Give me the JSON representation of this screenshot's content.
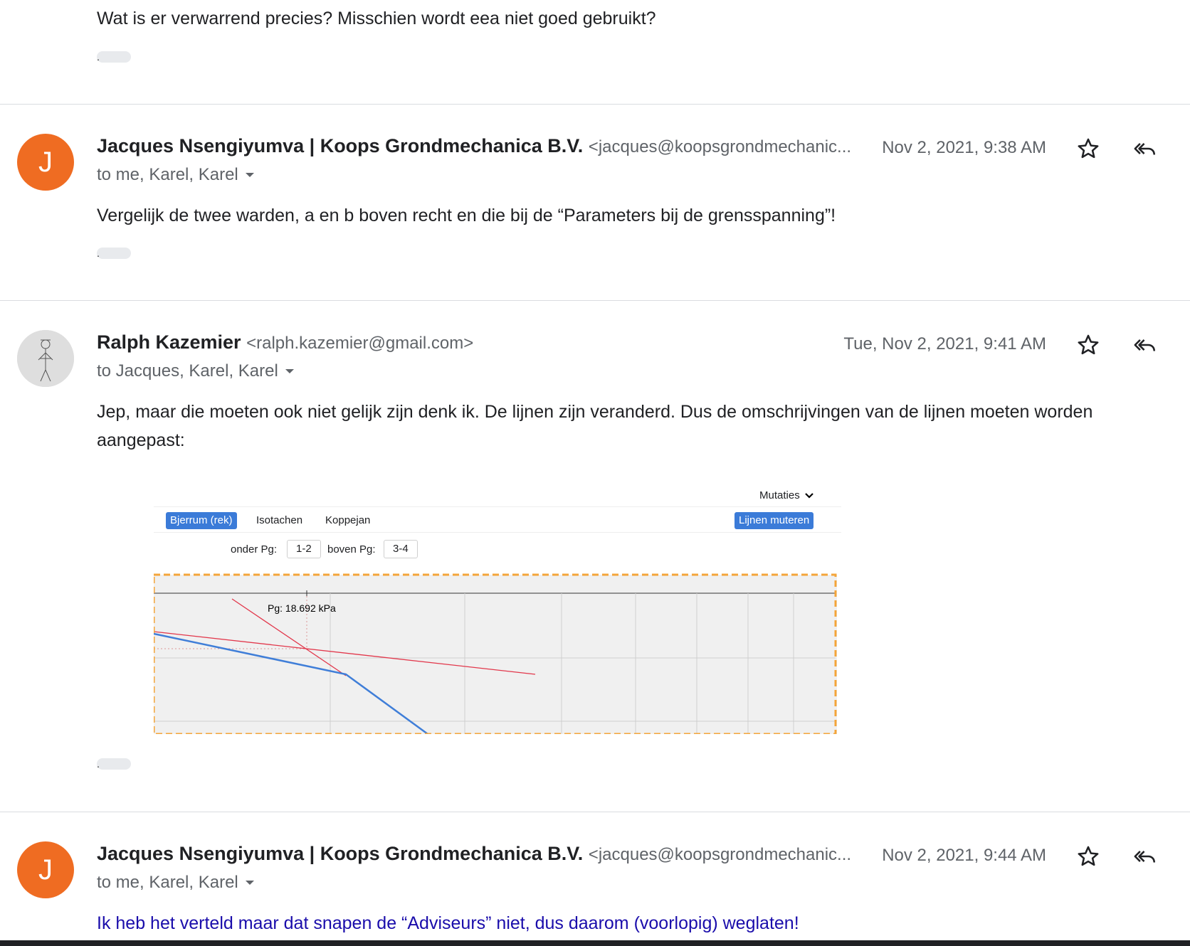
{
  "messages": [
    {
      "body": "Wat is er verwarrend precies? Misschien wordt eea niet goed gebruikt?"
    },
    {
      "avatar_letter": "J",
      "sender_name": "Jacques Nsengiyumva | Koops Grondmechanica B.V.",
      "sender_email": "<jacques@koopsgrondmechanic...",
      "date": "Nov 2, 2021, 9:38 AM",
      "recipients": "to me, Karel, Karel",
      "body": "Vergelijk de twee warden, a en b boven recht en die bij de “Parameters bij de grensspanning”!"
    },
    {
      "sender_name": "Ralph Kazemier",
      "sender_email": "<ralph.kazemier@gmail.com>",
      "date": "Tue, Nov 2, 2021, 9:41 AM",
      "recipients": "to Jacques, Karel, Karel",
      "body": "Jep, maar die moeten ook niet gelijk zijn denk ik. De lijnen zijn veranderd. Dus de omschrijvingen van de lijnen moeten worden aangepast:"
    },
    {
      "avatar_letter": "J",
      "sender_name": "Jacques Nsengiyumva | Koops Grondmechanica B.V.",
      "sender_email": "<jacques@koopsgrondmechanic...",
      "date": "Nov 2, 2021, 9:44 AM",
      "recipients": "to me, Karel, Karel",
      "body": "Ik heb het verteld maar dat snapen de “Adviseurs” niet,  dus daarom (voorlopig) weglaten!"
    }
  ],
  "trimmed_dot": ".",
  "embedded_screenshot": {
    "dropdown_label": "Mutaties",
    "tabs": [
      "Bjerrum (rek)",
      "Isotachen",
      "Koppejan"
    ],
    "active_tab": "Bjerrum (rek)",
    "action_button": "Lijnen muteren",
    "onder_label": "onder Pg:",
    "onder_value": "1-2",
    "boven_label": "boven Pg:",
    "boven_value": "3-4",
    "plot_annotation": "Pg: 18.692 kPa"
  },
  "colors": {
    "avatar_orange": "#ef6c22",
    "link_blue": "#1a0dab",
    "tab_blue": "#3b7bd8",
    "plot_red": "#e2374b",
    "plot_blue": "#3f7ed8",
    "selection_orange": "#f4a53a"
  },
  "icons": [
    "star-icon",
    "reply-all-icon",
    "dropdown-arrow-icon",
    "chevron-down-icon"
  ]
}
